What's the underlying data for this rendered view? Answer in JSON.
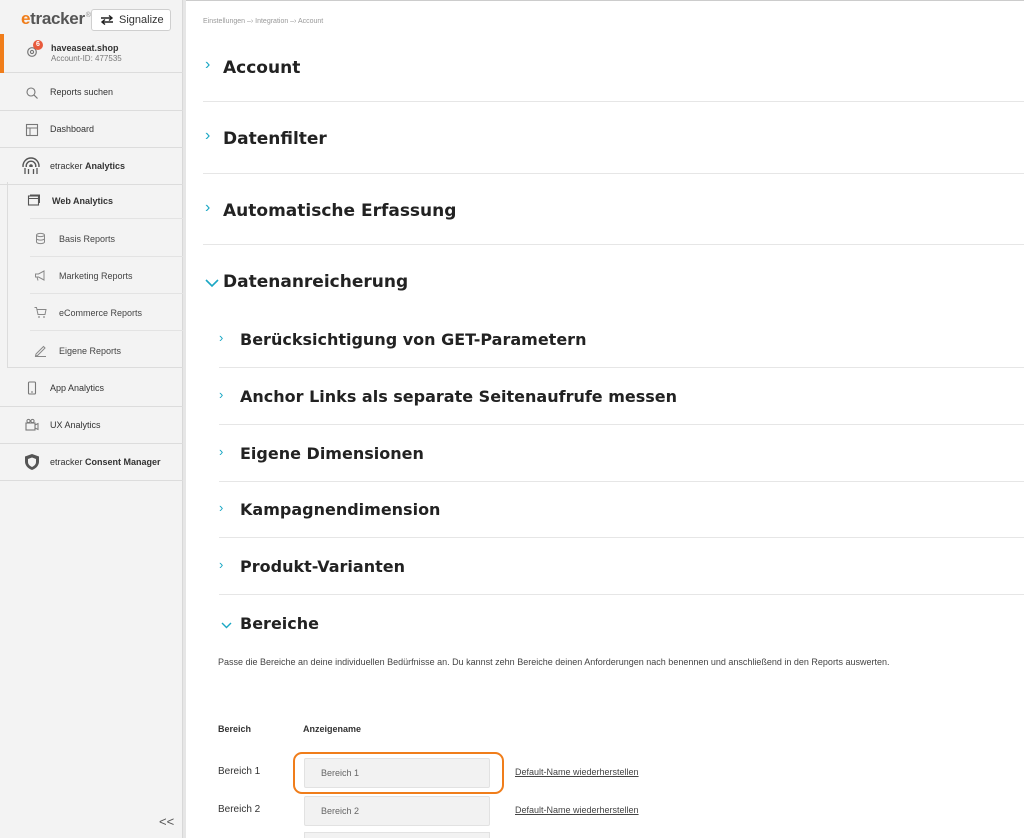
{
  "app": {
    "logo_text": "etracker",
    "signalize_label": "Signalize"
  },
  "account": {
    "name": "haveaseat.shop",
    "id_label": "Account-ID: 477535",
    "badge_count": "6"
  },
  "sidebar": {
    "items": [
      {
        "label": "Reports suchen",
        "icon": "search-icon"
      },
      {
        "label": "Dashboard",
        "icon": "dashboard-icon"
      },
      {
        "label_prefix": "etracker ",
        "label_bold": "Analytics",
        "icon": "analytics-logo-icon"
      },
      {
        "label": "Web Analytics",
        "icon": "browser-window-icon"
      },
      {
        "label": "Basis Reports",
        "icon": "database-icon"
      },
      {
        "label": "Marketing Reports",
        "icon": "megaphone-icon"
      },
      {
        "label": "eCommerce Reports",
        "icon": "cart-icon"
      },
      {
        "label": "Eigene Reports",
        "icon": "pen-icon"
      },
      {
        "label": "App Analytics",
        "icon": "phone-icon"
      },
      {
        "label": "UX Analytics",
        "icon": "camera-icon"
      },
      {
        "label_prefix": "etracker ",
        "label_bold": "Consent Manager",
        "icon": "shield-icon"
      }
    ],
    "collapse_label": "<<"
  },
  "breadcrumb": "Einstellungen –› Integration –› Account",
  "sections": [
    {
      "title": "Account",
      "expanded": false
    },
    {
      "title": "Datenfilter",
      "expanded": false
    },
    {
      "title": "Automatische Erfassung",
      "expanded": false
    },
    {
      "title": "Datenanreicherung",
      "expanded": true
    }
  ],
  "subsections": [
    {
      "title": "Berücksichtigung von GET-Parametern",
      "expanded": false
    },
    {
      "title": "Anchor Links als separate Seitenaufrufe messen",
      "expanded": false
    },
    {
      "title": "Eigene Dimensionen",
      "expanded": false
    },
    {
      "title": "Kampagnendimension",
      "expanded": false
    },
    {
      "title": "Produkt-Varianten",
      "expanded": false
    },
    {
      "title": "Bereiche",
      "expanded": true
    }
  ],
  "bereiche": {
    "description": "Passe die Bereiche an deine individuellen Bedürfnisse an. Du kannst zehn Bereiche deinen Anforderungen nach benennen und anschließend in den Reports auswerten.",
    "col_bereich": "Bereich",
    "col_anzeigename": "Anzeigename",
    "rows": [
      {
        "label": "Bereich 1",
        "value": "Bereich 1",
        "restore": "Default-Name wiederherstellen"
      },
      {
        "label": "Bereich 2",
        "value": "Bereich 2",
        "restore": "Default-Name wiederherstellen"
      }
    ]
  },
  "colors": {
    "accent": "#f07d1a",
    "chevron": "#1aa7c4",
    "badge": "#e85a3c"
  }
}
